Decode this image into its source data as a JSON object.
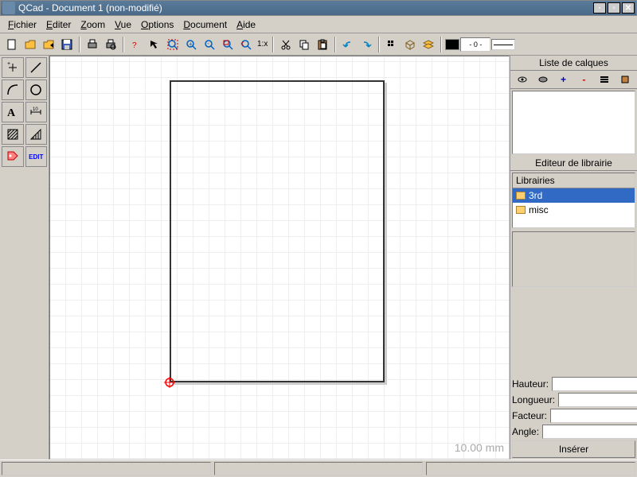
{
  "window": {
    "title": "QCad - Document 1 (non-modifié)"
  },
  "menu": {
    "items": [
      {
        "label": "Fichier",
        "u": 0
      },
      {
        "label": "Editer",
        "u": 0
      },
      {
        "label": "Zoom",
        "u": 0
      },
      {
        "label": "Vue",
        "u": 0
      },
      {
        "label": "Options",
        "u": 0
      },
      {
        "label": "Document",
        "u": 0
      },
      {
        "label": "Aide",
        "u": 0
      }
    ]
  },
  "toolbar": {
    "zoom_ratio": "1:x",
    "color_value": "- 0 -"
  },
  "canvas": {
    "scale_text": "10.00 mm"
  },
  "layers": {
    "title": "Liste de calques",
    "toolbar_icons": [
      "eye-icon",
      "freeze-icon",
      "add-icon",
      "remove-icon",
      "edit-icon",
      "close-icon"
    ]
  },
  "library": {
    "title": "Editeur de librairie",
    "tree_header": "Librairies",
    "items": [
      {
        "name": "3rd",
        "selected": true
      },
      {
        "name": "misc",
        "selected": false
      }
    ],
    "fields": {
      "height": "Hauteur:",
      "length": "Longueur:",
      "factor": "Facteur:",
      "angle": "Angle:"
    },
    "insert_label": "Insérer"
  },
  "tool_palette": {
    "edit_label": "EDIT"
  }
}
